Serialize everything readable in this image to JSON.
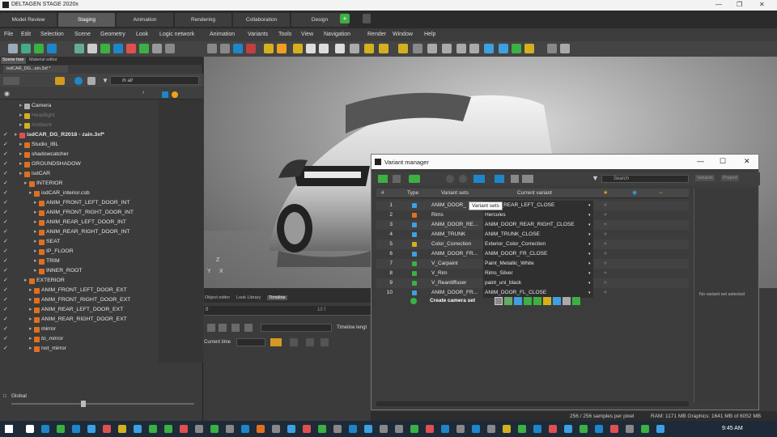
{
  "window": {
    "title": "DELTAGEN STAGE 2020x"
  },
  "mode_tabs": [
    "Model Review",
    "Staging",
    "Animation",
    "Rendering",
    "Collaboration",
    "Design"
  ],
  "mode_tabs_active": 1,
  "menu": [
    "File",
    "Edit",
    "Selection",
    "Scene",
    "Geometry",
    "Look",
    "Logic network",
    "Animation",
    "Variants",
    "Tools",
    "View",
    "Navigation",
    "Render",
    "Window",
    "Help"
  ],
  "left_panel": {
    "tabs": [
      "Scene tree",
      "Material editor"
    ],
    "file_tab": "isdCAR_DG...ain.3xf *",
    "filter_text": "In all",
    "global_label": "Global",
    "tree": [
      {
        "label": "Camera",
        "depth": 1,
        "checked": false,
        "icon": "camera",
        "bold": false
      },
      {
        "label": "Headlight",
        "depth": 1,
        "checked": false,
        "icon": "light",
        "dim": true
      },
      {
        "label": "Ambient",
        "depth": 1,
        "checked": false,
        "icon": "light",
        "dim": true
      },
      {
        "label": "isdCAR_DG_R2018 - zain.3xf*",
        "depth": 0,
        "checked": true,
        "icon": "file",
        "bold": true
      },
      {
        "label": "Studio_IBL",
        "depth": 1,
        "checked": true,
        "icon": "node"
      },
      {
        "label": "shadowcatcher",
        "depth": 1,
        "checked": true,
        "icon": "node"
      },
      {
        "label": "GROUNDSHADOW",
        "depth": 1,
        "checked": true,
        "icon": "node"
      },
      {
        "label": "isdCAR",
        "depth": 1,
        "checked": true,
        "icon": "node"
      },
      {
        "label": "INTERIOR",
        "depth": 2,
        "checked": true,
        "icon": "node"
      },
      {
        "label": "isdCAR_interior.csb",
        "depth": 3,
        "checked": true,
        "icon": "node"
      },
      {
        "label": "ANIM_FRONT_LEFT_DOOR_INT",
        "depth": 4,
        "checked": true,
        "icon": "node"
      },
      {
        "label": "ANIM_FRONT_RIGHT_DOOR_INT",
        "depth": 4,
        "checked": true,
        "icon": "node"
      },
      {
        "label": "ANIM_REAR_LEFT_DOOR_INT",
        "depth": 4,
        "checked": true,
        "icon": "node"
      },
      {
        "label": "ANIM_REAR_RIGHT_DOOR_INT",
        "depth": 4,
        "checked": true,
        "icon": "node"
      },
      {
        "label": "SEAT",
        "depth": 4,
        "checked": true,
        "icon": "node"
      },
      {
        "label": "IP_FLOOR",
        "depth": 4,
        "checked": true,
        "icon": "node"
      },
      {
        "label": "TRIM",
        "depth": 4,
        "checked": true,
        "icon": "node"
      },
      {
        "label": "INNER_ROOT",
        "depth": 4,
        "checked": true,
        "icon": "node"
      },
      {
        "label": "EXTERIOR",
        "depth": 2,
        "checked": true,
        "icon": "node"
      },
      {
        "label": "ANIM_FRONT_LEFT_DOOR_EXT",
        "depth": 3,
        "checked": true,
        "icon": "node"
      },
      {
        "label": "ANIM_FRONT_RIGHT_DOOR_EXT",
        "depth": 3,
        "checked": true,
        "icon": "node"
      },
      {
        "label": "ANIM_REAR_LEFT_DOOR_EXT",
        "depth": 3,
        "checked": true,
        "icon": "node"
      },
      {
        "label": "ANIM_REAR_RIGHT_DOOR_EXT",
        "depth": 3,
        "checked": true,
        "icon": "node"
      },
      {
        "label": "mirror",
        "depth": 3,
        "checked": true,
        "icon": "node"
      },
      {
        "label": "to_mirror",
        "depth": 3,
        "checked": true,
        "icon": "node",
        "italic": true
      },
      {
        "label": "not_mirror",
        "depth": 3,
        "checked": true,
        "icon": "node"
      }
    ]
  },
  "bottom_panel": {
    "tabs": [
      "Object editor",
      "Look Library",
      "Timeline"
    ],
    "active_tab": 2,
    "timeline_start": "0",
    "timeline_mid": "10 f",
    "timeline_length_label": "Timeline lengt",
    "current_time_label": "Current time"
  },
  "variant_manager": {
    "title": "Variant manager",
    "search_placeholder": "Search",
    "side_tabs": [
      "Variants",
      "Propert"
    ],
    "columns": [
      "#",
      "Type",
      "Variant sets",
      "Current variant"
    ],
    "tooltip": "Variant sets",
    "rows": [
      {
        "n": "1",
        "type": "anim",
        "set": "ANIM_DOOR_",
        "variant": "DOOR_REAR_LEFT_CLOSE"
      },
      {
        "n": "2",
        "type": "geo",
        "set": "Rims",
        "variant": "Hercules"
      },
      {
        "n": "3",
        "type": "anim",
        "set": "ANIM_DOOR_RE...",
        "variant": "ANIM_DOOR_REAR_RIGHT_CLOSE"
      },
      {
        "n": "4",
        "type": "anim",
        "set": "ANIM_TRUNK",
        "variant": "ANIM_TRUNK_CLOSE"
      },
      {
        "n": "5",
        "type": "mat",
        "set": "Color_Correction",
        "variant": "Exterior_Color_Correction"
      },
      {
        "n": "6",
        "type": "anim",
        "set": "ANIM_DOOR_FR...",
        "variant": "ANIM_DOOR_FR_CLOSE"
      },
      {
        "n": "7",
        "type": "look",
        "set": "V_Carpaint",
        "variant": "Paint_Metallic_White"
      },
      {
        "n": "8",
        "type": "look",
        "set": "V_Rim",
        "variant": "Rims_Silver"
      },
      {
        "n": "9",
        "type": "look",
        "set": "V_Reardiffuser",
        "variant": "paint_uni_black"
      },
      {
        "n": "10",
        "type": "anim",
        "set": "ANIM_DOOR_FR...",
        "variant": "ANIM_DOOR_FL_CLOSE"
      }
    ],
    "create_camera_set": "Create camera set",
    "side_note": "No variant set selected"
  },
  "status": {
    "samples": "256 / 256 samples per pixel",
    "memory": "RAM: 1171 MB Graphics: 1641 MB of 6052 MB"
  },
  "taskbar": {
    "time": "9:45 AM"
  },
  "colors": {
    "accent": "#f0a020",
    "green": "#3cb043",
    "blue": "#2a7fd4",
    "selected_row": "#565656"
  }
}
